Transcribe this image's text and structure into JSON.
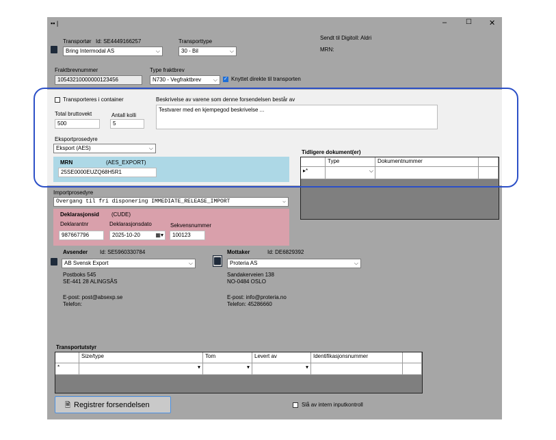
{
  "titlebar": {
    "app_glyph": "▪▪ |",
    "minimize": "–",
    "maximize": "☐",
    "close": "✕"
  },
  "transport": {
    "transportor_label": "Transportør",
    "transportor_id": "Id: SE4449166257",
    "transportor_value": "Bring Intermodal AS",
    "transporttype_label": "Transporttype",
    "transporttype_value": "30 - Bil",
    "sendt_til": "Sendt til Digitoll: Aldri",
    "mrn_label": "MRN:"
  },
  "fraktbrev": {
    "nr_label": "Fraktbrevnummer",
    "nr_value": "10543210000000123456",
    "type_label": "Type fraktbrev",
    "type_value": "N730 - Vegfraktbrev",
    "knyttet_label": "Knyttet direkte til transporten",
    "knyttet_checked": true
  },
  "shipment": {
    "container_label": "Transporteres i container",
    "container_checked": false,
    "beskrivelse_label": "Beskrivelse av varene som denne forsendelsen består av",
    "beskrivelse_value": "Testvarer med en kjempegod beskrivelse ...",
    "bruttovekt_label": "Total bruttovekt",
    "bruttovekt_value": "500",
    "kolli_label": "Antall kolli",
    "kolli_value": "5",
    "eksport_label": "Eksportprosedyre",
    "eksport_value": "Eksport (AES)",
    "mrn_title": "MRN",
    "mrn_type": "(AES_EXPORT)",
    "mrn_value": "25SE0000EUZQ68H5R1"
  },
  "docs": {
    "title": "Tidligere dokument(er)",
    "col_type": "Type",
    "col_nr": "Dokumentnummer",
    "row_marker": "▸*"
  },
  "import": {
    "label": "Importprosedyre",
    "value": "Overgang til fri disponering   IMMEDIATE_RELEASE_IMPORT",
    "dekl_title": "Deklarasjonsid",
    "dekl_type": "(CUDE)",
    "dekl_nr_label": "Deklarantnr",
    "dekl_nr_value": "987667796",
    "dekl_dato_label": "Deklarasjonsdato",
    "dekl_dato_value": "2025-10-20",
    "sekv_label": "Sekvensnummer",
    "sekv_value": "100123"
  },
  "avsender": {
    "title": "Avsender",
    "id": "Id: SE5960330784",
    "name": "AB Svensk Export",
    "line1": "Postboks 545",
    "line2": "SE-441 28 ALINGSÅS",
    "epost": "E-post:  post@absexp.se",
    "telefon": "Telefon:"
  },
  "mottaker": {
    "title": "Mottaker",
    "id": "Id: DE6829392",
    "name": "Proteria AS",
    "line1": "Sandakerveien 138",
    "line2": "NO-0484 OSLO",
    "epost": "E-post:  info@proteria.no",
    "telefon": "Telefon: 45286660"
  },
  "utstyr": {
    "title": "Transportutstyr",
    "cols": [
      "Size/type",
      "Tom",
      "Levert av",
      "Identifikasjonsnummer"
    ],
    "row_marker": "*"
  },
  "footer": {
    "register_label": "Registrer forsendelsen",
    "intern_label": "Slå av intern inputkontroll",
    "intern_checked": false
  },
  "colors": {
    "window": "#a6a6a6",
    "mrn_panel": "#add8e6",
    "dekl_panel": "#d9a0ab",
    "highlight": "#2b4fc7",
    "shipment_panel": "#f0f0f0"
  }
}
